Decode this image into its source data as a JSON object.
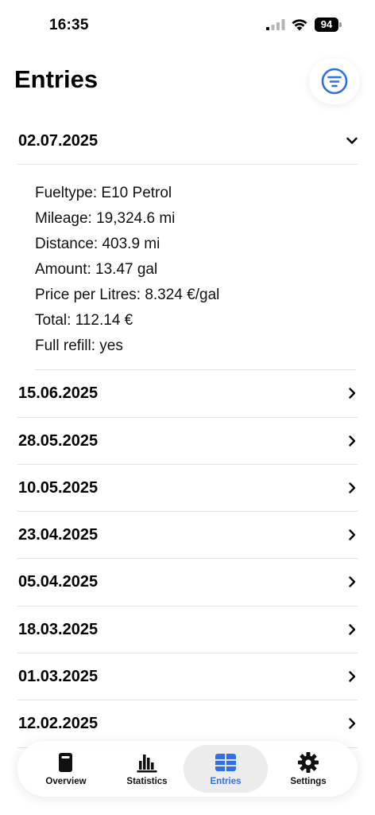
{
  "status": {
    "time": "16:35",
    "battery": "94"
  },
  "header": {
    "title": "Entries",
    "filter_icon": "filter-icon"
  },
  "expanded_entry": {
    "date": "02.07.2025",
    "details": [
      "Fueltype: E10 Petrol",
      "Mileage: 19,324.6 mi",
      "Distance: 403.9 mi",
      "Amount: 13.47 gal",
      "Price per Litres: 8.324 €/gal",
      "Total: 112.14 €",
      "Full refill: yes"
    ]
  },
  "entries": [
    "15.06.2025",
    "28.05.2025",
    "10.05.2025",
    "23.04.2025",
    "05.04.2025",
    "18.03.2025",
    "01.03.2025",
    "12.02.2025"
  ],
  "tabs": [
    {
      "label": "Overview",
      "icon": "fuel-pump-icon",
      "active": false
    },
    {
      "label": "Statistics",
      "icon": "bar-chart-icon",
      "active": false
    },
    {
      "label": "Entries",
      "icon": "table-icon",
      "active": true
    },
    {
      "label": "Settings",
      "icon": "gear-icon",
      "active": false
    }
  ],
  "colors": {
    "accent": "#2f6fe8",
    "divider": "#e3e3e3",
    "tab_active_bg": "#ececec"
  }
}
